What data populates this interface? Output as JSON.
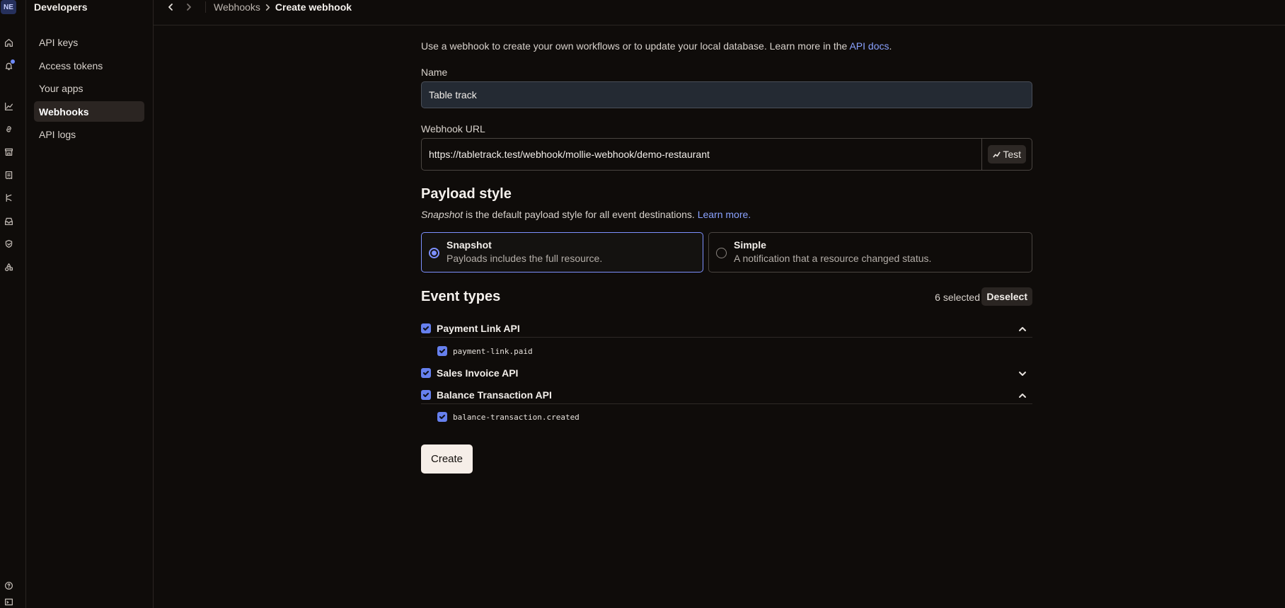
{
  "rail": {
    "org_initials": "NE",
    "icons": [
      "home-icon",
      "bell-icon",
      "chart-icon",
      "link-icon",
      "store-icon",
      "receipt-icon",
      "branch-icon",
      "inbox-icon",
      "shield-icon",
      "shapes-icon",
      "help-icon",
      "terminal-icon"
    ]
  },
  "sidebar": {
    "title": "Developers",
    "items": [
      {
        "label": "API keys",
        "active": false
      },
      {
        "label": "Access tokens",
        "active": false
      },
      {
        "label": "Your apps",
        "active": false
      },
      {
        "label": "Webhooks",
        "active": true
      },
      {
        "label": "API logs",
        "active": false
      }
    ]
  },
  "breadcrumb": {
    "parent": "Webhooks",
    "current": "Create webhook"
  },
  "form": {
    "intro_text": "Use a webhook to create your own workflows or to update your local database. Learn more in the ",
    "intro_link": "API docs",
    "intro_end": ".",
    "name_label": "Name",
    "name_value": "Table track",
    "url_label": "Webhook URL",
    "url_value": "https://tabletrack.test/webhook/mollie-webhook/demo-restaurant",
    "test_label": "Test",
    "payload_heading": "Payload style",
    "payload_sub_em": "Snapshot",
    "payload_sub_text": " is the default payload style for all event destinations. ",
    "payload_sub_link": "Learn more.",
    "options": [
      {
        "title": "Snapshot",
        "desc": "Payloads includes the full resource.",
        "selected": true
      },
      {
        "title": "Simple",
        "desc": "A notification that a resource changed status.",
        "selected": false
      }
    ],
    "events_heading": "Event types",
    "selected_count": "6 selected",
    "deselect_label": "Deselect",
    "groups": [
      {
        "name": "Payment Link API",
        "checked": true,
        "expanded": true,
        "events": [
          "payment-link.paid"
        ]
      },
      {
        "name": "Sales Invoice API",
        "checked": true,
        "expanded": false,
        "events": []
      },
      {
        "name": "Balance Transaction API",
        "checked": true,
        "expanded": true,
        "events": [
          "balance-transaction.created"
        ]
      }
    ],
    "create_label": "Create"
  },
  "colors": {
    "background": "#0f0c0a",
    "accent": "#7d90ff",
    "link": "#8aa2ff",
    "checkbox": "#6680ee"
  }
}
